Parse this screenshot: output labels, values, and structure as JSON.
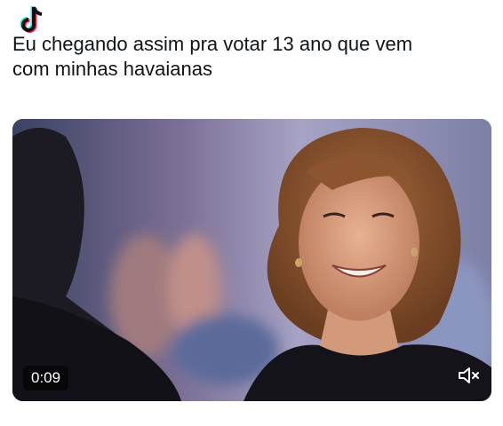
{
  "post": {
    "line1": "Eu chegando assim pra votar 13 ano que vem",
    "line2": "com minhas havaianas"
  },
  "video": {
    "elapsed_time": "0:09",
    "muted": true
  },
  "icons": {
    "watermark": "tiktok-logo-icon",
    "mute": "speaker-muted-icon"
  }
}
